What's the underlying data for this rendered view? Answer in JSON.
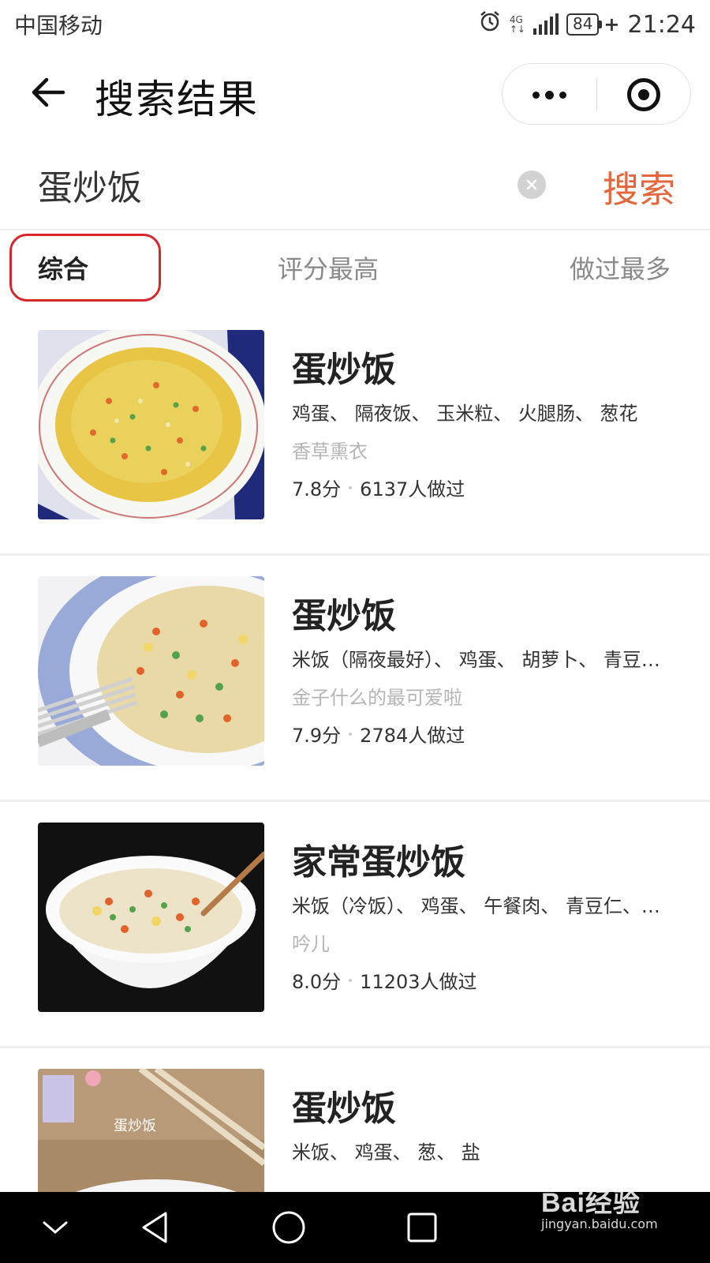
{
  "status_bar": {
    "carrier": "中国移动",
    "network_top": "4G",
    "network_bottom": "↑↓",
    "battery": "84",
    "time": "21:24",
    "icons": [
      "alarm-icon",
      "signal-icon",
      "battery-icon"
    ]
  },
  "header": {
    "back_icon": "back-arrow-icon",
    "title": "搜索结果",
    "capsule_icons": [
      "more-dots-icon",
      "close-target-icon"
    ]
  },
  "search": {
    "value": "蛋炒饭",
    "clear_icon": "clear-icon",
    "button_label": "搜索",
    "accent_color": "#e4663c"
  },
  "tabs": [
    {
      "label": "综合",
      "active": true
    },
    {
      "label": "评分最高",
      "active": false
    },
    {
      "label": "做过最多",
      "active": false
    }
  ],
  "highlight_color": "#d9262c",
  "results": [
    {
      "title": "蛋炒饭",
      "ingredients": "鸡蛋、 隔夜饭、 玉米粒、 火腿肠、 葱花",
      "author": "香草熏衣",
      "rating": "7.8分",
      "made_count": "6137人做过",
      "image": "fried-rice-plate-image"
    },
    {
      "title": "蛋炒饭",
      "ingredients": "米饭（隔夜最好）、 鸡蛋、 胡萝卜、 青豆…",
      "author": "金子什么的最可爱啦",
      "rating": "7.9分",
      "made_count": "2784人做过",
      "image": "fried-rice-with-fork-image"
    },
    {
      "title": "家常蛋炒饭",
      "ingredients": "米饭（冷饭）、 鸡蛋、 午餐肉、 青豆仁、…",
      "author": "吟儿",
      "rating": "8.0分",
      "made_count": "11203人做过",
      "image": "fried-rice-bowl-image"
    },
    {
      "title": "蛋炒饭",
      "ingredients": "米饭、 鸡蛋、 葱、 盐",
      "author": "",
      "rating": "",
      "made_count": "",
      "image": "fried-rice-chopsticks-image",
      "image_caption": "蛋炒饭"
    }
  ],
  "nav_bar": {
    "icons": [
      "collapse-chevron-icon",
      "back-triangle-icon",
      "home-circle-icon",
      "recents-square-icon"
    ]
  },
  "watermark": {
    "brand": "Bai经验",
    "url": "jingyan.baidu.com"
  }
}
